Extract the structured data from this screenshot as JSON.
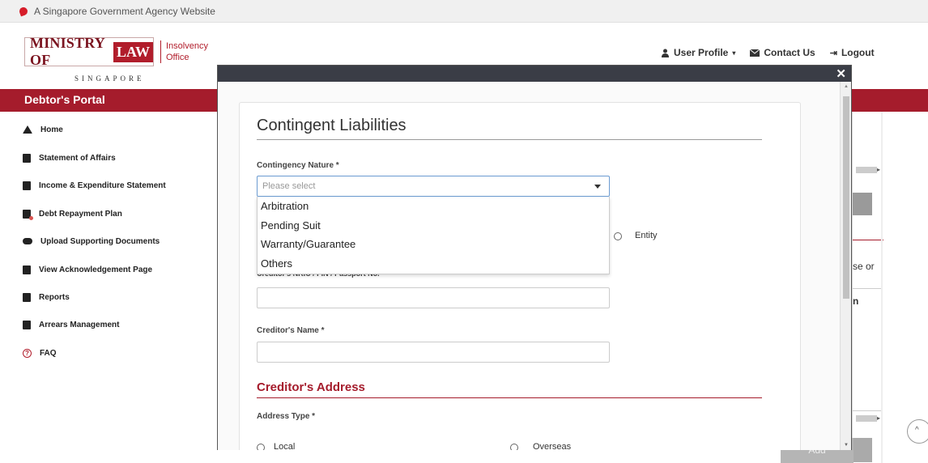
{
  "gov_banner": {
    "text": "A Singapore Government Agency Website"
  },
  "logo": {
    "ministry": "MINISTRY OF",
    "law": "LAW",
    "country": "SINGAPORE",
    "office_line1": "Insolvency",
    "office_line2": "Office"
  },
  "top_nav": {
    "user_profile": "User Profile",
    "contact_us": "Contact Us",
    "logout": "Logout"
  },
  "portal": {
    "title": "Debtor's Portal"
  },
  "sidebar": {
    "items": [
      {
        "label": "Home",
        "icon": "home-icon"
      },
      {
        "label": "Statement of Affairs",
        "icon": "file-icon"
      },
      {
        "label": "Income & Expenditure Statement",
        "icon": "calculator-icon"
      },
      {
        "label": "Debt Repayment Plan",
        "icon": "plan-icon"
      },
      {
        "label": "Upload Supporting Documents",
        "icon": "cloud-upload-icon"
      },
      {
        "label": "View Acknowledgement Page",
        "icon": "document-icon"
      },
      {
        "label": "Reports",
        "icon": "book-icon"
      },
      {
        "label": "Arrears Management",
        "icon": "clipboard-icon"
      },
      {
        "label": "FAQ",
        "icon": "question-icon"
      }
    ]
  },
  "background": {
    "partial_text_1": "se or",
    "partial_text_2": "n",
    "partial_button": "Add"
  },
  "modal": {
    "title": "Contingent Liabilities",
    "contingency_nature_label": "Contingency Nature *",
    "contingency_placeholder": "Please select",
    "contingency_options": [
      "Arbitration",
      "Pending Suit",
      "Warranty/Guarantee",
      "Others"
    ],
    "entity_label": "Entity",
    "creditor_id_label": "Creditor's NRIC / FIN / Passport No.",
    "creditor_name_label": "Creditor's Name *",
    "address_section": "Creditor's Address",
    "address_type_label": "Address Type *",
    "address_local": "Local",
    "address_overseas": "Overseas"
  },
  "colors": {
    "brand_red": "#a51c2c",
    "modal_bar": "#3a3d46",
    "focus_border": "#6b9bd1"
  }
}
